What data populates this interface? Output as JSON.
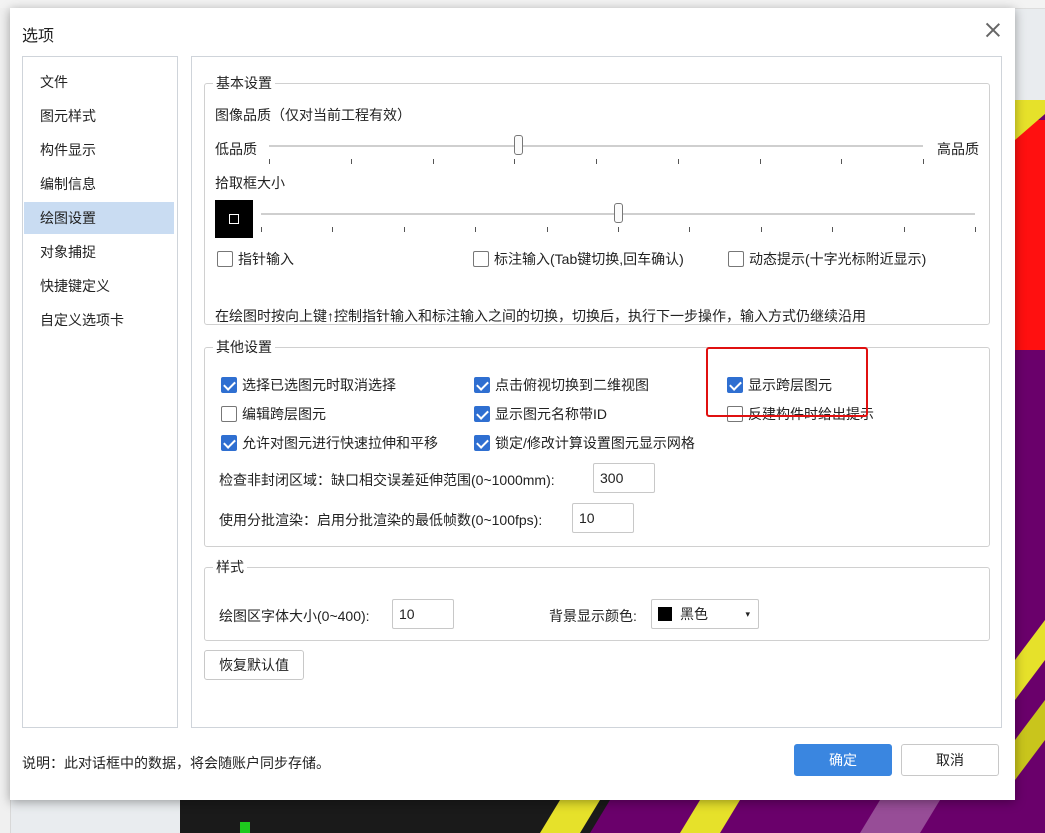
{
  "dialog": {
    "title": "选项"
  },
  "nav": {
    "items": [
      "文件",
      "图元样式",
      "构件显示",
      "编制信息",
      "绘图设置",
      "对象捕捉",
      "快捷键定义",
      "自定义选项卡"
    ],
    "active": "绘图设置"
  },
  "basic": {
    "legend": "基本设置",
    "quality_label": "图像品质（仅对当前工程有效）",
    "low": "低品质",
    "high": "高品质",
    "quality_value_fraction": 0.38,
    "pick_label": "拾取框大小",
    "pick_value_fraction": 0.5,
    "checkboxes": [
      {
        "label": "指针输入",
        "checked": false
      },
      {
        "label": "标注输入(Tab键切换,回车确认)",
        "checked": false
      },
      {
        "label": "动态提示(十字光标附近显示)",
        "checked": false
      }
    ],
    "hint": "在绘图时按向上键↑控制指针输入和标注输入之间的切换，切换后，执行下一步操作，输入方式仍继续沿用"
  },
  "other": {
    "legend": "其他设置",
    "checkboxes": [
      {
        "label": "选择已选图元时取消选择",
        "checked": true
      },
      {
        "label": "点击俯视切换到二维视图",
        "checked": true
      },
      {
        "label": "显示跨层图元",
        "checked": true
      },
      {
        "label": "编辑跨层图元",
        "checked": false
      },
      {
        "label": "显示图元名称带ID",
        "checked": true
      },
      {
        "label": "反建构件时给出提示",
        "checked": false
      },
      {
        "label": "允许对图元进行快速拉伸和平移",
        "checked": true
      },
      {
        "label": "锁定/修改计算设置图元显示网格",
        "checked": true
      }
    ],
    "check_label": "检查非封闭区域：缺口相交误差延伸范围(0~1000mm):",
    "check_value": "300",
    "batch_label": "使用分批渲染：启用分批渲染的最低帧数(0~100fps):",
    "batch_value": "10"
  },
  "style": {
    "legend": "样式",
    "font_label": "绘图区字体大小(0~400):",
    "font_value": "10",
    "bg_label": "背景显示颜色:",
    "bg_value": "黑色",
    "bg_swatch": "#000000"
  },
  "buttons": {
    "restore": "恢复默认值",
    "ok": "确定",
    "cancel": "取消"
  },
  "footer_note": "说明：此对话框中的数据，将会随账户同步存储。",
  "colors": {
    "accent": "#3a86e0",
    "highlight": "#e01010",
    "nav_active": "#c9dcf2"
  }
}
